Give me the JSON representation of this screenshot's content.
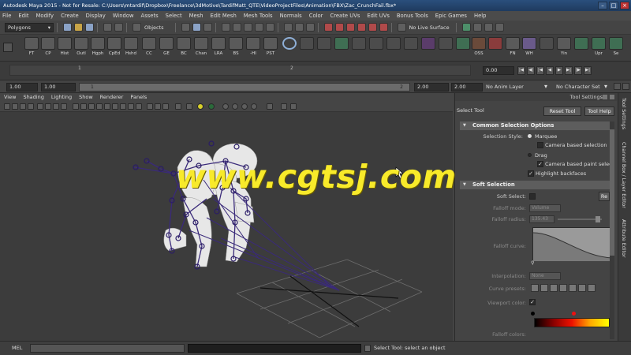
{
  "window": {
    "title": "Autodesk Maya 2015 - Not for Resale: C:\\Users\\mtardif\\Dropbox\\Freelance\\3dMotive\\TardifMatt_QTE\\VideoProjectFiles\\Animation\\FBX\\Zac_CrunchFail.fbx*"
  },
  "menus": [
    "File",
    "Edit",
    "Modify",
    "Create",
    "Display",
    "Window",
    "Assets",
    "Select",
    "Mesh",
    "Edit Mesh",
    "Mesh Tools",
    "Normals",
    "Color",
    "Create UVs",
    "Edit UVs",
    "Bonus Tools",
    "Epic Games",
    "Help"
  ],
  "statusline": {
    "mode": "Polygons",
    "selection": "Objects",
    "live_surface": "No Live Surface"
  },
  "shelf": [
    "FT",
    "CP",
    "Hist",
    "Outl",
    "Hgph",
    "CpEd",
    "Hshd",
    "CC",
    "GE",
    "BC",
    "Chan",
    "LRA",
    "BS",
    "-HI",
    "PST",
    "",
    "",
    "",
    "",
    "",
    "",
    "",
    "",
    "",
    "",
    "",
    "OSS",
    "",
    "FN",
    "WH",
    "",
    "Yin",
    "",
    "Upr",
    "Se"
  ],
  "timeline": {
    "ticks": [
      "1",
      "2"
    ],
    "current_frame": "0.00"
  },
  "range": {
    "start": "1.00",
    "inner_start": "1.00",
    "slider_start": "1",
    "slider_end": "2",
    "end": "2.00",
    "outer_end": "2.00",
    "anim_layer": "No Anim Layer",
    "character_set": "No Character Set"
  },
  "viewport": {
    "menus": [
      "View",
      "Shading",
      "Lighting",
      "Show",
      "Renderer",
      "Panels"
    ]
  },
  "tool_settings": {
    "header": "Tool Settings",
    "tool_name": "Select Tool",
    "reset_label": "Reset Tool",
    "help_label": "Tool Help",
    "common_section": "Common Selection Options",
    "selection_style_label": "Selection Style:",
    "marquee": "Marquee",
    "camera_based_selection": "Camera based selection",
    "drag": "Drag",
    "camera_based_paint": "Camera based paint select",
    "highlight_backfaces": "Highlight backfaces",
    "soft_section": "Soft Selection",
    "soft_select_label": "Soft Select:",
    "reset_short": "Re",
    "falloff_mode_label": "Falloff mode:",
    "falloff_mode_value": "Volume",
    "falloff_radius_label": "Falloff radius:",
    "falloff_radius_value": "135.43",
    "falloff_curve_label": "Falloff curve:",
    "interpolation_label": "Interpolation:",
    "interpolation_value": "None",
    "curve_presets_label": "Curve presets:",
    "viewport_color_label": "Viewport color:",
    "falloff_colors_label": "Falloff colors:"
  },
  "side_tabs": [
    "Tool Settings",
    "Channel Box / Layer Editor",
    "Attribute Editor"
  ],
  "command_line": {
    "language": "MEL",
    "help_message": "Select Tool: select an object"
  },
  "watermark": "www.cgtsj.com",
  "colors": {
    "title_bar": "#1f3b5f",
    "panel": "#444444",
    "viewport": "#3c3c3c",
    "rig": "#3a2a7a",
    "watermark": "#f8ea2a"
  }
}
